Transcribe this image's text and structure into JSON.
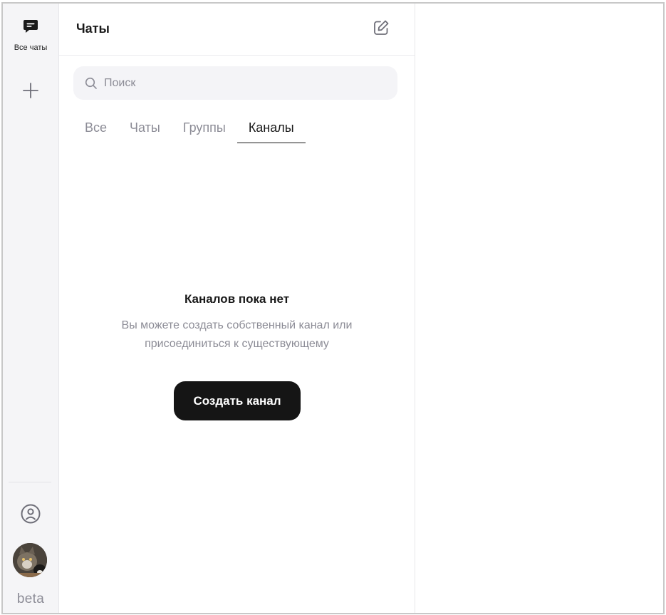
{
  "rail": {
    "all_chats_label": "Все чаты",
    "beta_label": "beta",
    "icons": {
      "all_chats": "chat-bubble-icon",
      "add": "plus-icon",
      "profile": "profile-circle-icon",
      "avatar": "user-avatar-cat"
    }
  },
  "panel": {
    "title": "Чаты",
    "compose_icon": "compose-edit-icon",
    "search": {
      "placeholder": "Поиск",
      "value": ""
    },
    "tabs": [
      {
        "label": "Все",
        "active": false
      },
      {
        "label": "Чаты",
        "active": false
      },
      {
        "label": "Группы",
        "active": false
      },
      {
        "label": "Каналы",
        "active": true
      }
    ],
    "empty_state": {
      "title": "Каналов пока нет",
      "description": "Вы можете создать собственный канал или присоединиться к существующему",
      "button_label": "Создать канал"
    }
  },
  "colors": {
    "rail_bg": "#f5f5f7",
    "primary_text": "#1a1a1a",
    "secondary_text": "#8c8c96",
    "button_bg": "#151515"
  }
}
